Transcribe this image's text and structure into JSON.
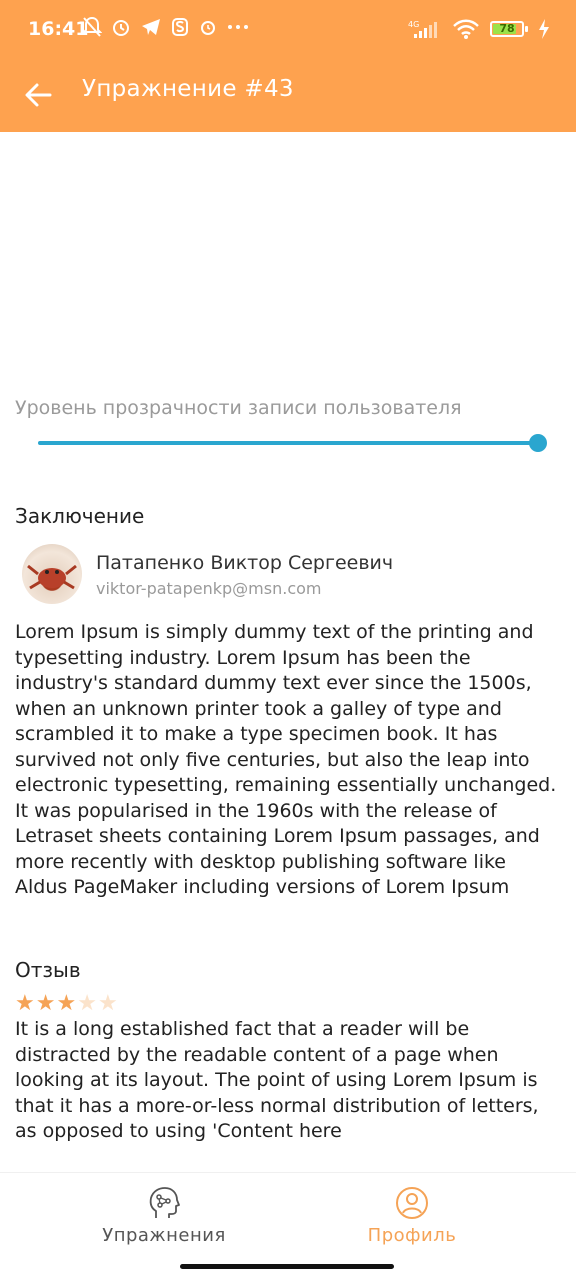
{
  "status_bar": {
    "time": "16:41",
    "battery": "78"
  },
  "header": {
    "title": "Упражнение #43",
    "back_icon": "arrow-left-icon"
  },
  "transparency": {
    "label": "Уровень прозрачности записи пользователя",
    "value_percent": 100
  },
  "conclusion": {
    "heading": "Заключение",
    "author_name": "Патапенко Виктор Сергеевич",
    "author_email": "viktor-patapenkp@msn.com",
    "text": "Lorem Ipsum is simply dummy text of the printing and typesetting industry. Lorem Ipsum has been the industry's standard dummy text ever since the 1500s, when an unknown printer took a galley of type and scrambled it to make a type specimen book. It has survived not only five centuries, but also the leap into electronic typesetting, remaining essentially unchanged. It was popularised in the 1960s with the release of Letraset sheets containing Lorem Ipsum passages, and more recently with desktop publishing software like Aldus PageMaker including versions of Lorem Ipsum"
  },
  "review": {
    "heading": "Отзыв",
    "rating": 3,
    "max_rating": 5,
    "text": "It is a long established fact that a reader will be distracted by the readable content of a page when looking at its layout. The point of using Lorem Ipsum is that it has a more-or-less normal distribution of letters, as opposed to using 'Content here"
  },
  "bottom_nav": {
    "items": [
      {
        "label": "Упражнения",
        "icon": "exercises-head-icon",
        "active": false
      },
      {
        "label": "Профиль",
        "icon": "profile-icon",
        "active": true
      }
    ]
  },
  "colors": {
    "accent": "#FEA24F",
    "slider": "#2aa6cf",
    "star_filled": "#F5A356",
    "star_empty": "#FBE3CB",
    "nav_inactive": "#555555"
  }
}
